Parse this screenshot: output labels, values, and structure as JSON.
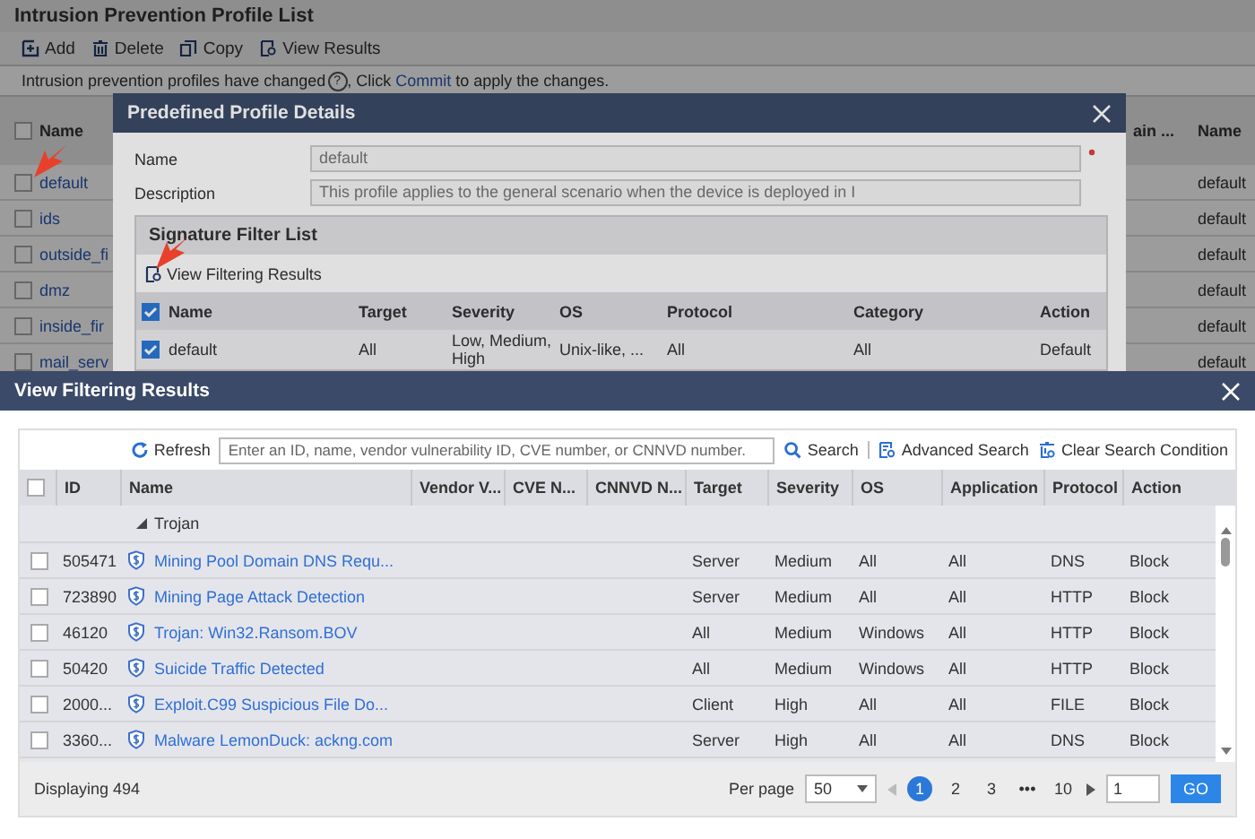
{
  "page": {
    "title": "Intrusion Prevention Profile List",
    "toolbar": [
      {
        "kind": "add",
        "label": "Add"
      },
      {
        "kind": "delete",
        "label": "Delete"
      },
      {
        "kind": "copy",
        "label": "Copy"
      },
      {
        "kind": "view",
        "label": "View Results"
      }
    ],
    "notice": {
      "text": "Intrusion prevention profiles have changed",
      "help": "?",
      "middle": ", Click ",
      "link": "Commit",
      "tail": " to apply the changes."
    },
    "table": {
      "all_checked": false,
      "columns": [
        "Name",
        "ain ...",
        "Name"
      ],
      "rows": [
        {
          "name": "default",
          "column_3": "default",
          "checked": false
        },
        {
          "name": "ids",
          "column_3": "default",
          "checked": false
        },
        {
          "name": "outside_fi",
          "column_3": "default",
          "checked": false
        },
        {
          "name": "dmz",
          "column_3": "default",
          "checked": false
        },
        {
          "name": "inside_fir",
          "column_3": "default",
          "checked": false
        },
        {
          "name": "mail_serv",
          "column_3": "default",
          "checked": false
        }
      ]
    }
  },
  "profile_dialog": {
    "title": "Predefined Profile Details",
    "fields": [
      {
        "label": "Name",
        "value": "default",
        "required": true
      },
      {
        "label": "Description",
        "value": "This profile applies to the general scenario when the device is deployed in I",
        "required": false
      }
    ],
    "filter_list": {
      "title": "Signature Filter List",
      "link": "View Filtering Results",
      "all_checked": true,
      "columns": [
        "Name",
        "Target",
        "Severity",
        "OS",
        "Protocol",
        "Category",
        "Action"
      ],
      "rows": [
        {
          "checked": true,
          "cells": [
            "default",
            "All",
            "Low, Medium, High",
            "Unix-like, ...",
            "All",
            "All",
            "Default"
          ]
        }
      ]
    }
  },
  "results_dialog": {
    "title": "View Filtering Results",
    "toolbar": {
      "refresh": "Refresh",
      "placeholder": "Enter an ID, name, vendor vulnerability ID, CVE number, or CNNVD number.",
      "search": "Search",
      "advanced": "Advanced Search",
      "clear": "Clear Search Condition"
    },
    "columns": [
      "ID",
      "Name",
      "Vendor V...",
      "CVE N...",
      "CNNVD N...",
      "Target",
      "Severity",
      "OS",
      "Application",
      "Protocol",
      "Action"
    ],
    "all_checked": false,
    "group": {
      "label": "Trojan",
      "expanded": true
    },
    "rows": [
      {
        "checked": false,
        "id": "505471",
        "name": "Mining Pool Domain DNS Requ...",
        "target": "Server",
        "severity": "Medium",
        "os": "All",
        "application": "All",
        "protocol": "DNS",
        "action": "Block"
      },
      {
        "checked": false,
        "id": "723890",
        "name": "Mining Page Attack Detection",
        "target": "Server",
        "severity": "Medium",
        "os": "All",
        "application": "All",
        "protocol": "HTTP",
        "action": "Block"
      },
      {
        "checked": false,
        "id": "46120",
        "name": "Trojan: Win32.Ransom.BOV",
        "target": "All",
        "severity": "Medium",
        "os": "Windows",
        "application": "All",
        "protocol": "HTTP",
        "action": "Block"
      },
      {
        "checked": false,
        "id": "50420",
        "name": "Suicide Traffic Detected",
        "target": "All",
        "severity": "Medium",
        "os": "Windows",
        "application": "All",
        "protocol": "HTTP",
        "action": "Block"
      },
      {
        "checked": false,
        "id": "2000...",
        "name": "Exploit.C99 Suspicious File Do...",
        "target": "Client",
        "severity": "High",
        "os": "All",
        "application": "All",
        "protocol": "FILE",
        "action": "Block"
      },
      {
        "checked": false,
        "id": "3360...",
        "name": "Malware LemonDuck: ackng.com",
        "target": "Server",
        "severity": "High",
        "os": "All",
        "application": "All",
        "protocol": "DNS",
        "action": "Block"
      }
    ],
    "footer": {
      "count": "Displaying 494",
      "per_page_label": "Per page",
      "per_page": "50",
      "pages": [
        {
          "label": "1",
          "selected": true
        },
        {
          "label": "2",
          "selected": false
        },
        {
          "label": "3",
          "selected": false
        },
        {
          "label": "•••",
          "selected": false
        },
        {
          "label": "10",
          "selected": false
        }
      ],
      "goto": "1",
      "go": "GO"
    }
  }
}
